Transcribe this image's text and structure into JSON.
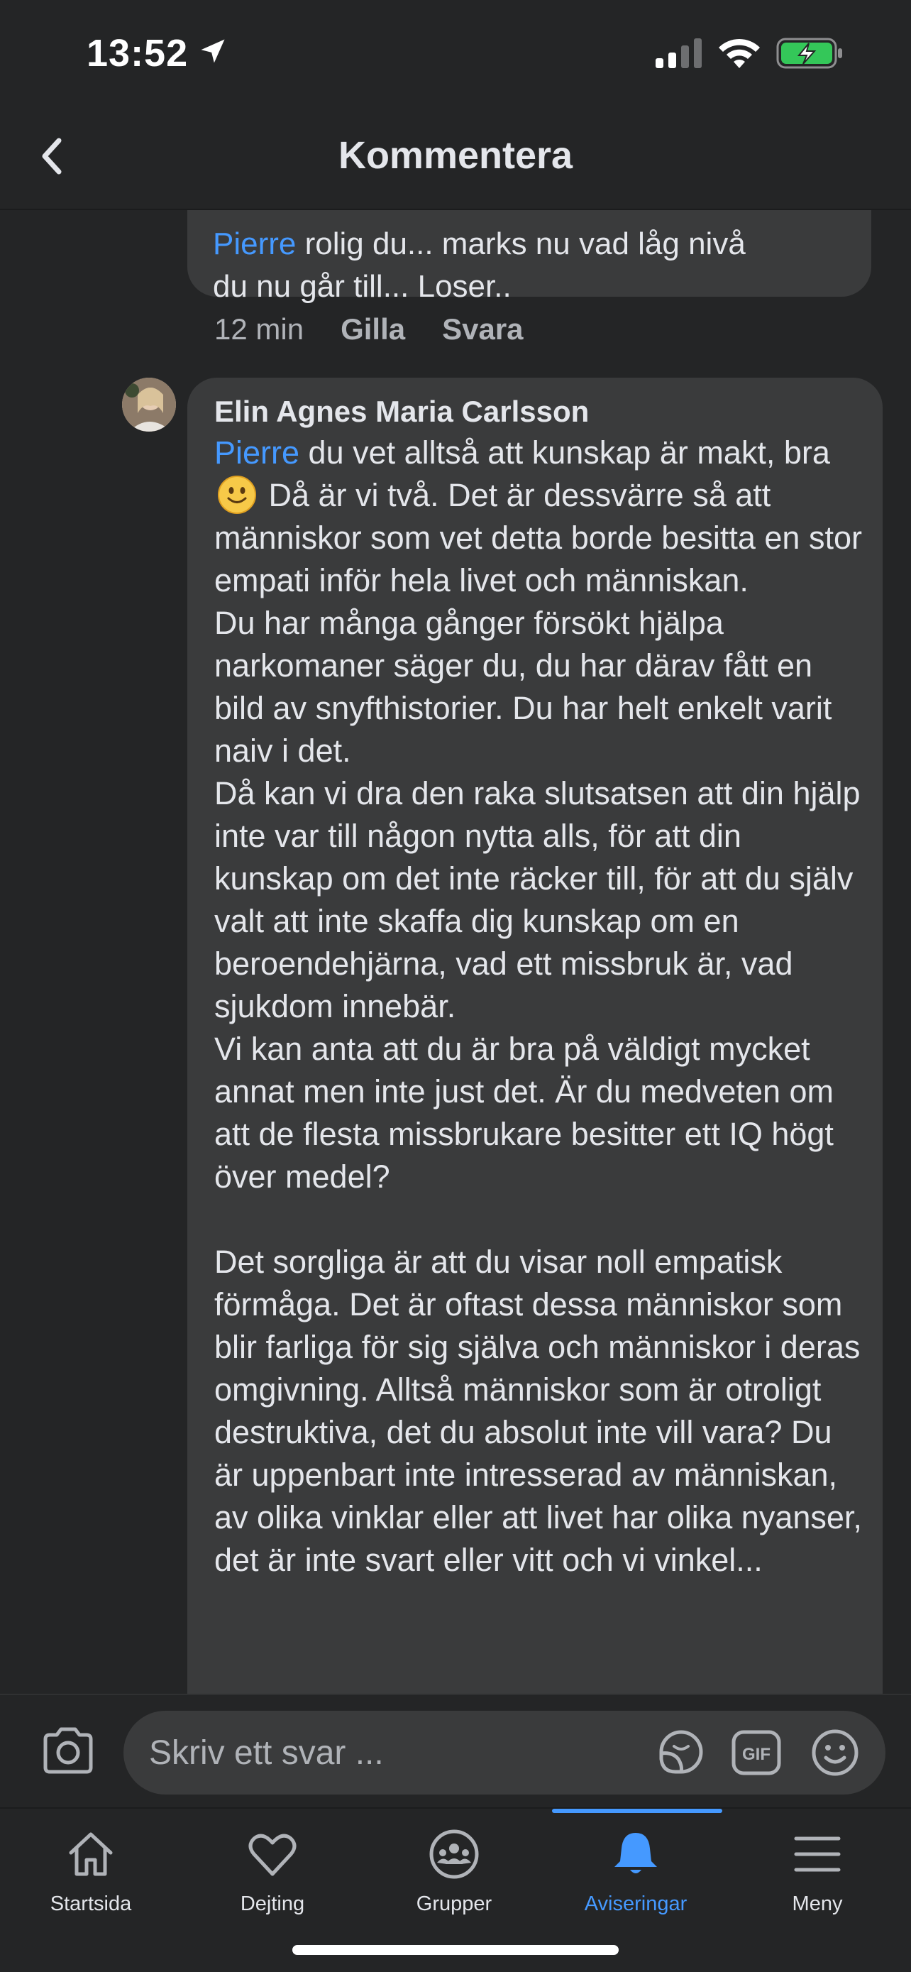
{
  "status_bar": {
    "time": "13:52"
  },
  "header": {
    "title": "Kommentera"
  },
  "previous_comment": {
    "mention": "Pierre",
    "line1_rest": " rolig du...  marks nu vad låg nivå",
    "line2": "du nu går till... Loser..",
    "time": "12 min",
    "like_label": "Gilla",
    "reply_label": "Svara"
  },
  "comment": {
    "author": "Elin Agnes Maria Carlsson",
    "mention": "Pierre",
    "intro": " du vet alltså att kunskap är makt, bra",
    "after_emoji": " Då är vi två. Det är dessvärre så att människor som vet detta borde besitta en stor empati inför hela livet och människan.",
    "paragraphs": [
      "Du har många gånger försökt hjälpa narkomaner säger du, du har därav fått en bild av snyfthistorier. Du har helt enkelt varit naiv i det.",
      "Då kan vi dra den raka slutsatsen att din hjälp inte var till någon nytta alls, för att din kunskap om det inte räcker till, för att du själv valt att inte skaffa dig kunskap om en beroendehjärna, vad ett missbruk är, vad sjukdom innebär.",
      "Vi kan anta att du är bra på väldigt mycket annat men inte just det. Är du medveten om att de flesta missbrukare besitter ett IQ högt över medel?",
      "",
      "Det sorgliga är att du visar noll empatisk förmåga. Det är oftast dessa människor som blir farliga för sig själva och människor i deras omgivning. Alltså människor som är otroligt destruktiva, det du absolut inte vill vara? Du är uppenbart inte intresserad av människan, av olika vinklar eller att livet har olika nyanser, det är inte svart eller vitt och vi vinkel..."
    ]
  },
  "composer": {
    "placeholder": "Skriv ett svar ..."
  },
  "tabs": [
    {
      "label": "Startsida",
      "icon": "home-icon"
    },
    {
      "label": "Dejting",
      "icon": "heart-icon"
    },
    {
      "label": "Grupper",
      "icon": "groups-icon"
    },
    {
      "label": "Aviseringar",
      "icon": "bell-icon",
      "active": true
    },
    {
      "label": "Meny",
      "icon": "menu-icon"
    }
  ],
  "colors": {
    "background": "#242526",
    "bubble": "#3a3b3c",
    "accent": "#4599ff",
    "muted": "#b0b3b8"
  }
}
